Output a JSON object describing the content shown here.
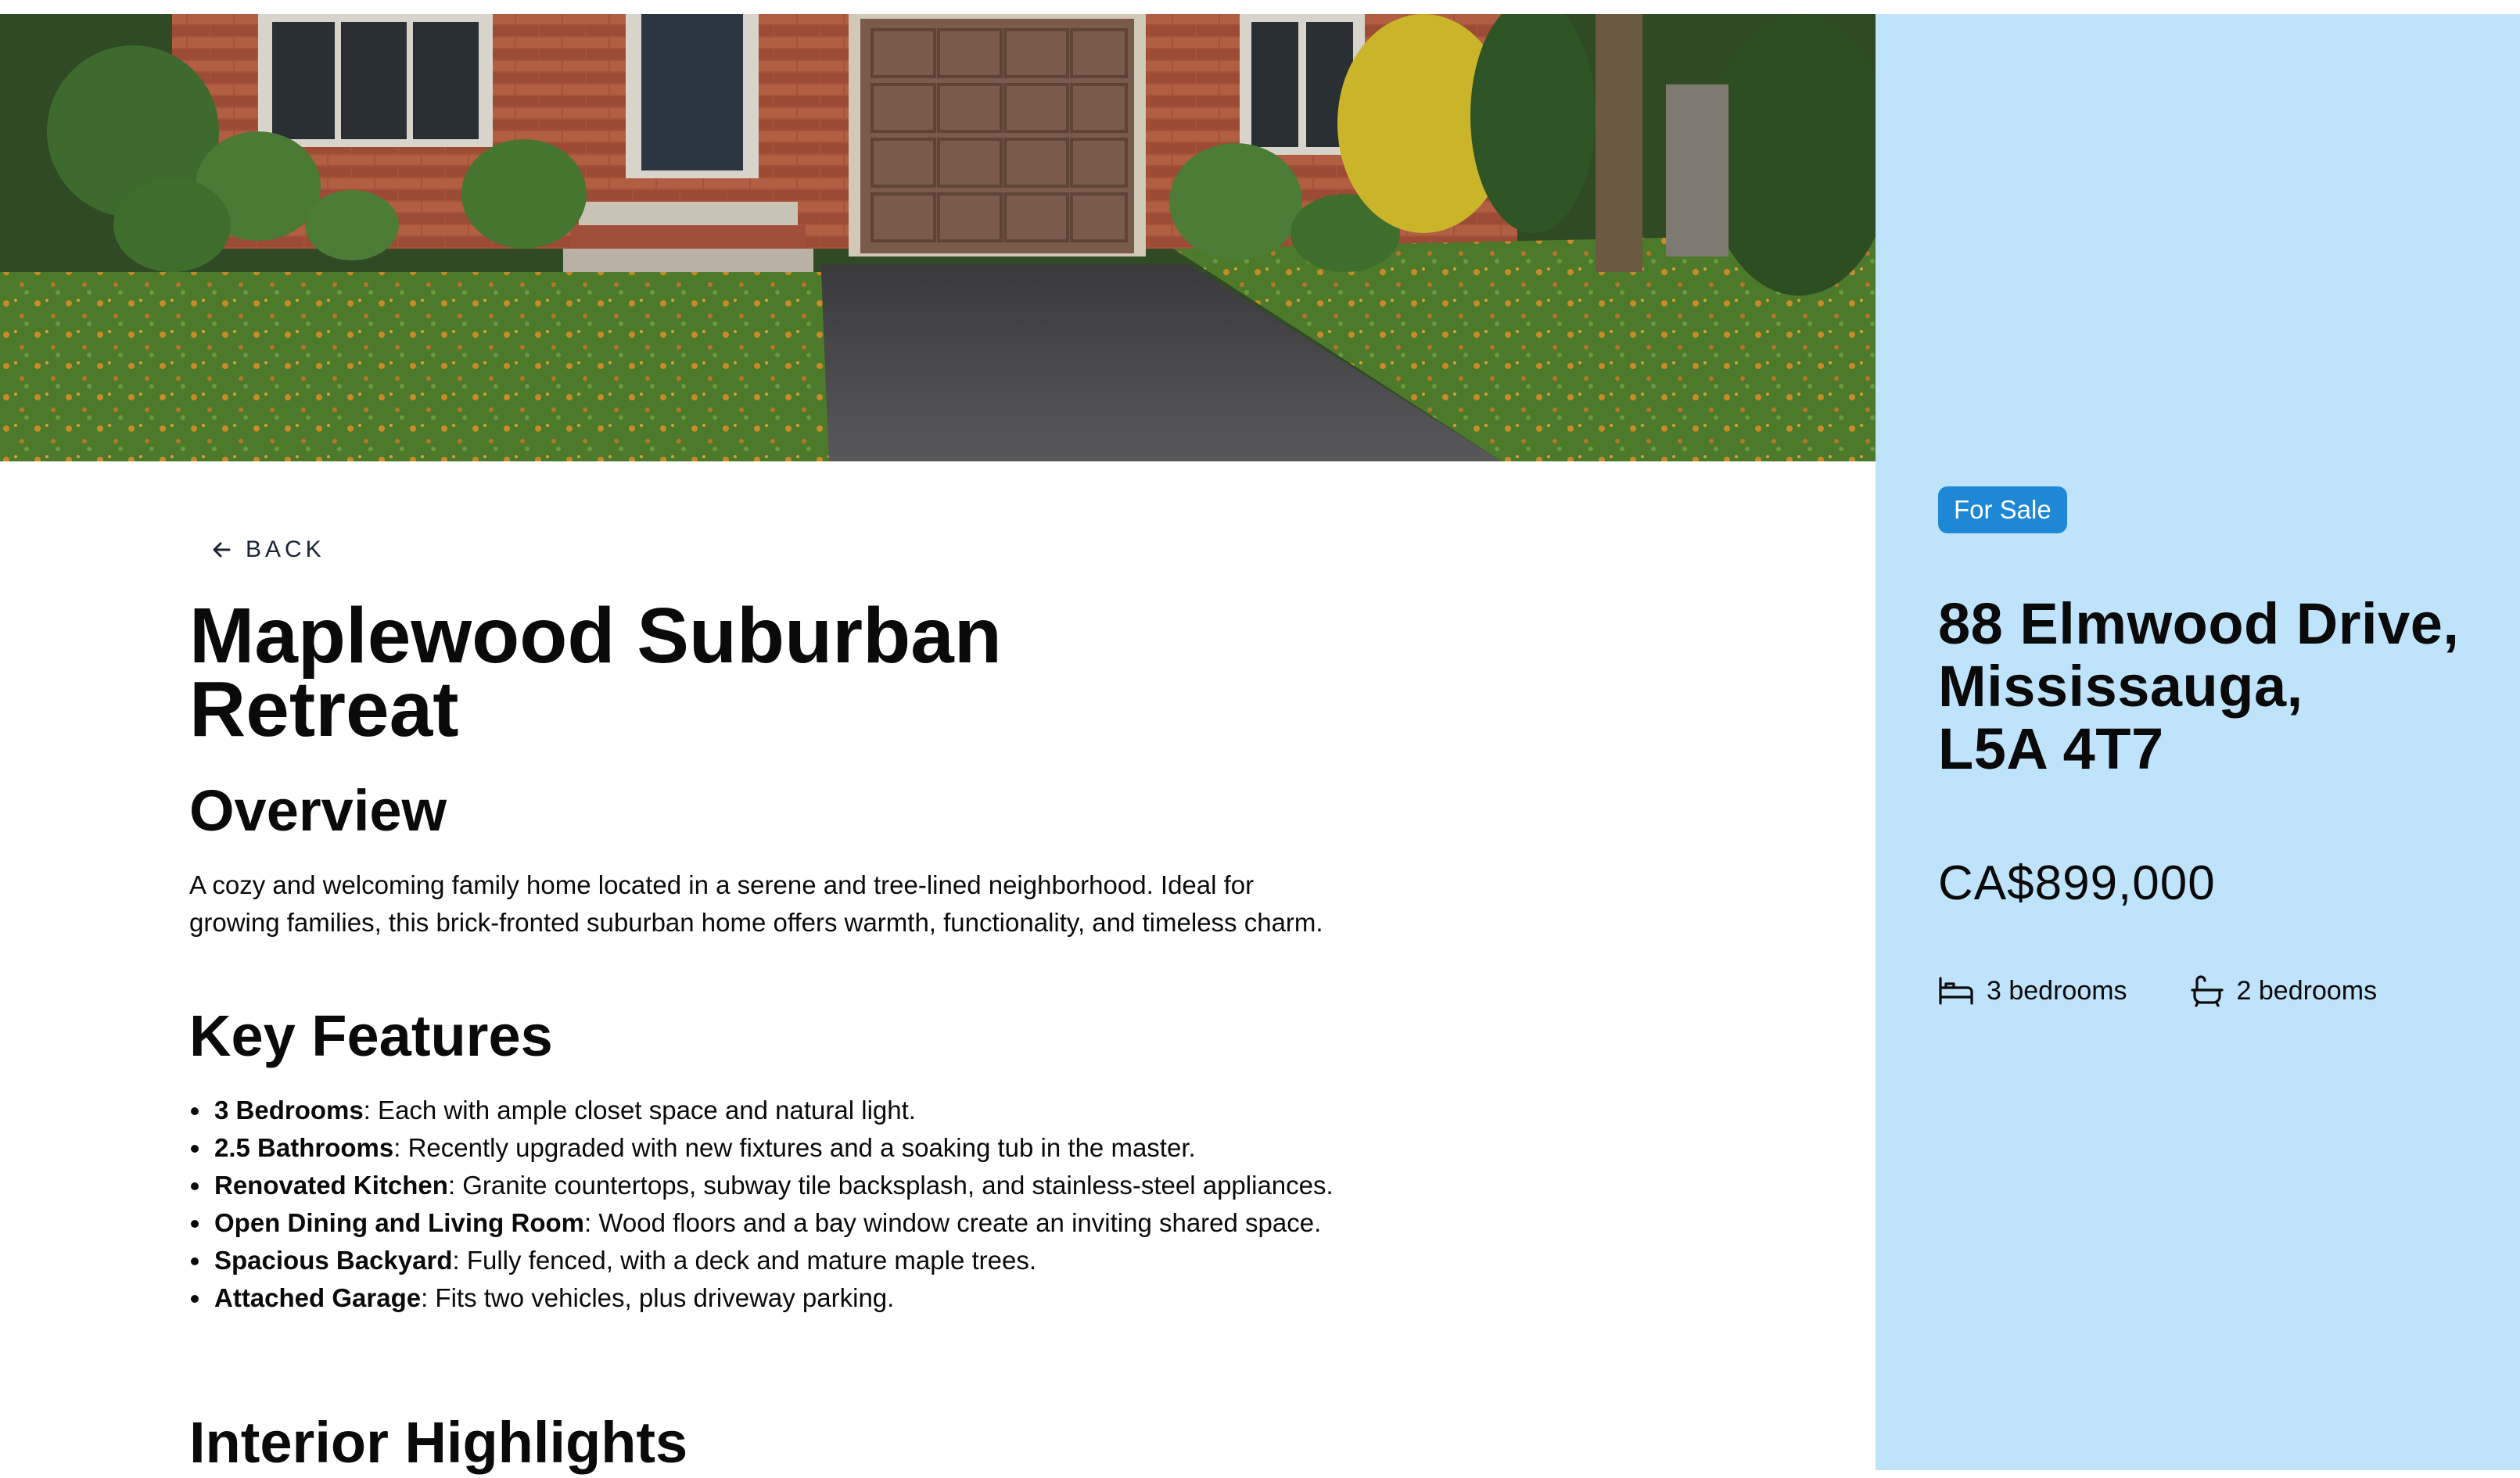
{
  "listing": {
    "status_badge": "For Sale",
    "address_line1": "88 Elmwood Drive,",
    "address_line2": "Mississauga,",
    "address_line3": "L5A 4T7",
    "price": "CA$899,000",
    "bedrooms": "3 bedrooms",
    "bathrooms": "2 bedrooms",
    "bed_icon": "bed-icon",
    "bath_icon": "bathtub-icon"
  },
  "hero": {
    "image": "house-photo"
  },
  "main": {
    "back_label": "BACK",
    "title": "Maplewood Suburban Retreat",
    "overview_heading": "Overview",
    "overview_text": "A cozy and welcoming family home located in a serene and tree-lined neighborhood. Ideal for growing families, this brick-fronted suburban home offers warmth, functionality, and timeless charm.",
    "features_heading": "Key Features",
    "features": [
      {
        "name": "3 Bedrooms",
        "text": ": Each with ample closet space and natural light."
      },
      {
        "name": "2.5 Bathrooms",
        "text": ": Recently upgraded with new fixtures and a soaking tub in the master."
      },
      {
        "name": "Renovated Kitchen",
        "text": ": Granite countertops, subway tile backsplash, and stainless-steel appliances."
      },
      {
        "name": "Open Dining and Living Room",
        "text": ": Wood floors and a bay window create an inviting shared space."
      },
      {
        "name": "Spacious Backyard",
        "text": ": Fully fenced, with a deck and mature maple trees."
      },
      {
        "name": "Attached Garage",
        "text": ": Fits two vehicles, plus driveway parking."
      }
    ],
    "interior_heading": "Interior Highlights"
  },
  "colors": {
    "sidebar_bg": "#bfe3fb",
    "badge_bg": "#1e88d6",
    "text": "#0a0a0a"
  }
}
